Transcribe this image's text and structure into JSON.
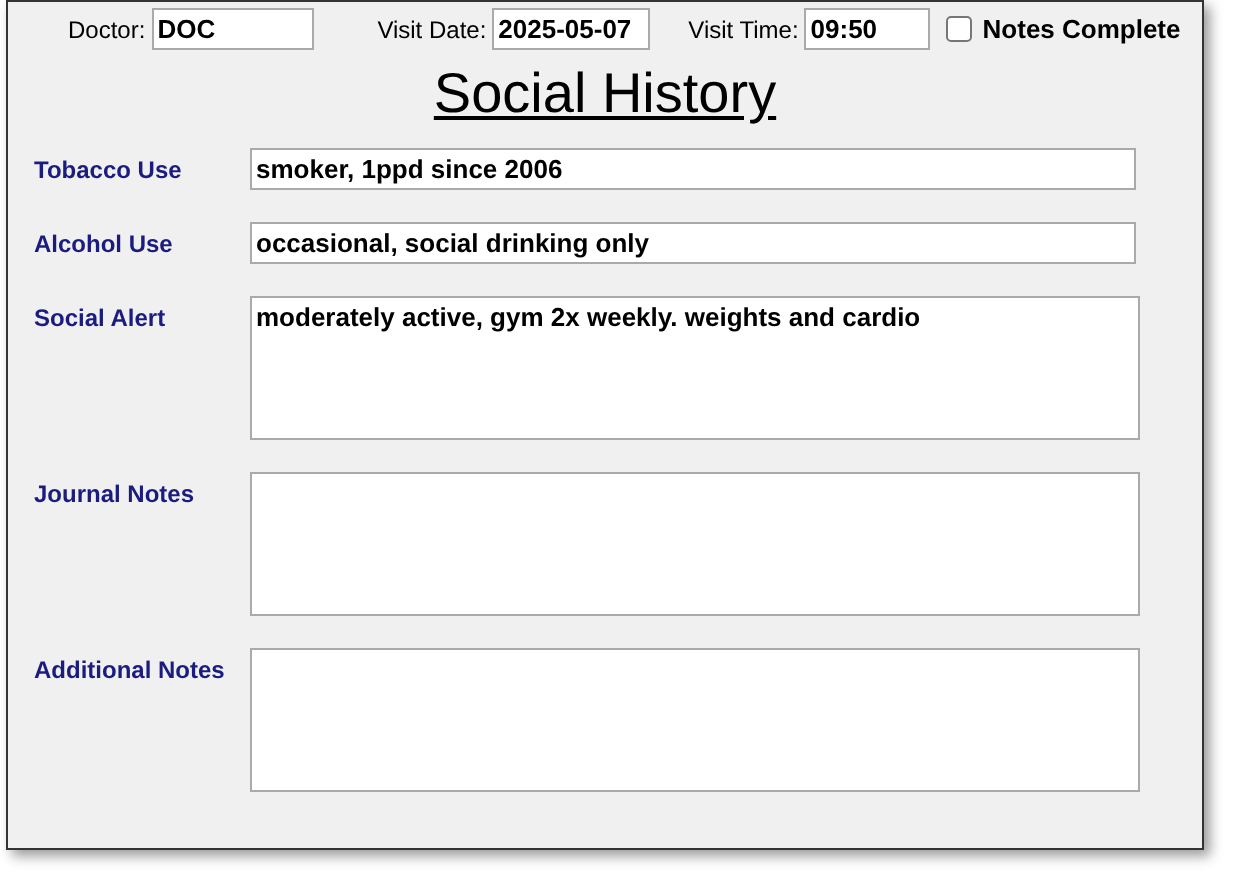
{
  "header": {
    "doctor": {
      "label": "Doctor:",
      "value": "DOC"
    },
    "visit_date": {
      "label": "Visit Date:",
      "value": "2025-05-07"
    },
    "visit_time": {
      "label": "Visit Time:",
      "value": "09:50"
    },
    "notes_complete": {
      "label": "Notes Complete",
      "checked": false
    }
  },
  "title": "Social History",
  "fields": [
    {
      "label": "Tobacco Use",
      "kind": "line",
      "value": "smoker, 1ppd since 2006"
    },
    {
      "label": "Alcohol Use",
      "kind": "line",
      "value": "occasional, social drinking only"
    },
    {
      "label": "Social Alert",
      "kind": "area",
      "value": "moderately active, gym 2x weekly. weights and cardio"
    },
    {
      "label": "Journal Notes",
      "kind": "area"
    },
    {
      "label": "Additional Notes",
      "kind": "area"
    }
  ]
}
